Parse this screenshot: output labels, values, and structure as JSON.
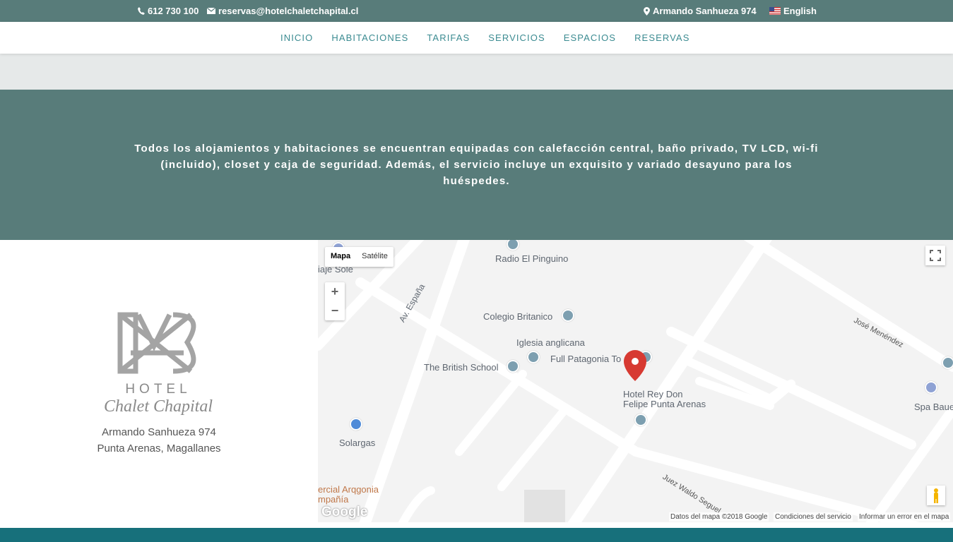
{
  "topbar": {
    "phone": "612 730 100",
    "email": "reservas@hotelchaletchapital.cl",
    "address": "Armando Sanhueza 974",
    "language": "English"
  },
  "nav": {
    "items": [
      "INICIO",
      "HABITACIONES",
      "TARIFAS",
      "SERVICIOS",
      "ESPACIOS",
      "RESERVAS"
    ]
  },
  "intro": {
    "text": "Todos los alojamientos y habitaciones se encuentran equipadas con calefacción central, baño privado, TV LCD, wi-fi (incluido), closet y caja de seguridad. Además, el servicio incluye un exquisito y variado desayuno para los huéspedes."
  },
  "logo": {
    "line1": "HOTEL",
    "line2": "Chalet Chapital"
  },
  "contact": {
    "street": "Armando Sanhueza 974",
    "city": "Punta Arenas, Magallanes"
  },
  "map": {
    "type_map": "Mapa",
    "type_satellite": "Satélite",
    "zoom_in": "+",
    "zoom_out": "−",
    "labels": {
      "radio": "Radio El Pinguino",
      "colegio": "Colegio Britanico",
      "iglesia": "Iglesia anglicana",
      "full": "Full Patagonia To",
      "british": "The British School",
      "hotel1": "Hotel Rey Don",
      "hotel2": "Felipe Punta Arenas",
      "solargas": "Solargas",
      "spa": "Spa Baue",
      "espana": "Av. España",
      "jose": "José Menéndez",
      "juez": "Juez Waldo Seguel",
      "comercial1": "ercial Arqgonia",
      "comercial2": "mpañía",
      "viaje": "iaje Sole"
    },
    "google": "Google",
    "attribution": "Datos del mapa ©2018 Google",
    "terms": "Condiciones del servicio",
    "report": "Informar un error en el mapa"
  },
  "colors": {
    "teal": "#587c7a",
    "nav_text": "#3b8b91",
    "footer": "#17707b"
  }
}
